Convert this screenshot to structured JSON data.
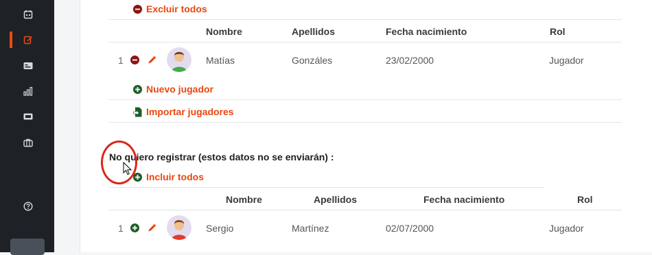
{
  "sidebar": {
    "icons": [
      "calendar-icon",
      "edit-icon",
      "id-card-icon",
      "bar-chart-icon",
      "ticket-icon",
      "briefcase-icon",
      "help-icon"
    ],
    "active_index": 1,
    "accent": "#ee4b12"
  },
  "registered": {
    "remove_all_label": "Excluir todos",
    "columns": [
      "Nombre",
      "Apellidos",
      "Fecha nacimiento",
      "Rol"
    ],
    "rows": [
      {
        "num": "1",
        "nombre": "Matías",
        "apellidos": "Gonzáles",
        "fecha": "23/02/2000",
        "rol": "Jugador"
      }
    ],
    "new_player_label": "Nuevo jugador",
    "import_label": "Importar jugadores"
  },
  "unregistered": {
    "note": "No quiero registrar (estos datos no se enviarán) :",
    "include_all_label": "Incluir todos",
    "columns": [
      "Nombre",
      "Apellidos",
      "Fecha nacimiento",
      "Rol"
    ],
    "rows": [
      {
        "num": "1",
        "nombre": "Sergio",
        "apellidos": "Martínez",
        "fecha": "02/07/2000",
        "rol": "Jugador"
      }
    ]
  },
  "colors": {
    "action_orange": "#e8470e",
    "remove_red": "#8b1414",
    "add_green": "#1f5e28",
    "highlight_ring": "#d9261c"
  }
}
